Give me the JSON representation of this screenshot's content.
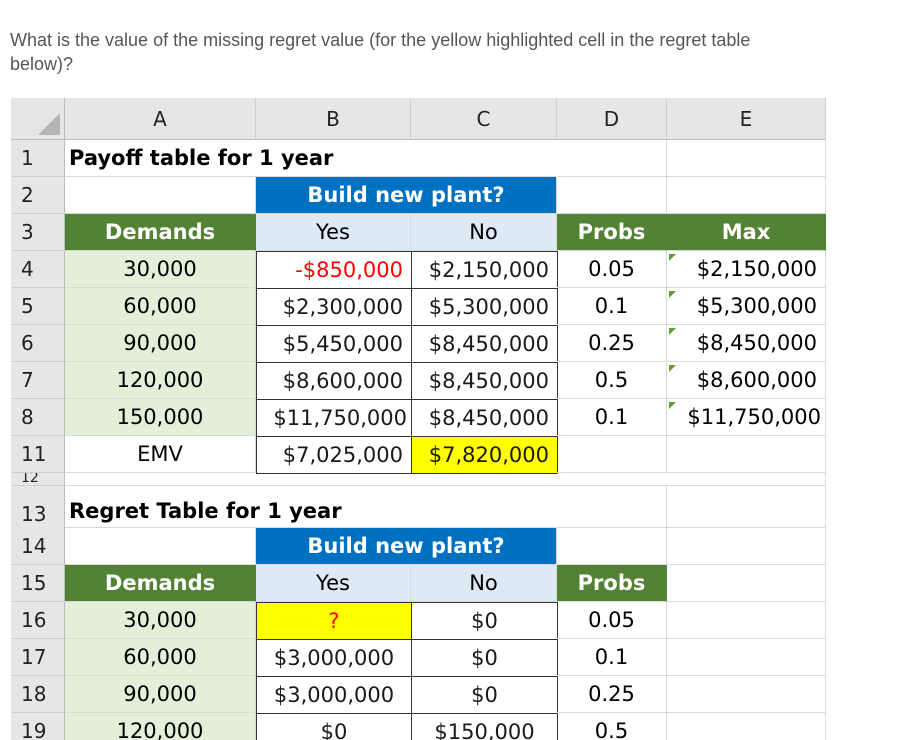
{
  "question": "What is the value of the missing regret value (for the yellow highlighted cell in the regret table below)?",
  "columns": [
    "A",
    "B",
    "C",
    "D",
    "E"
  ],
  "row_numbers": [
    "1",
    "2",
    "3",
    "4",
    "5",
    "6",
    "7",
    "8",
    "11",
    "12",
    "13",
    "14",
    "15",
    "16",
    "17",
    "18",
    "19"
  ],
  "payoff": {
    "title": "Payoff table for 1 year",
    "decision_header": "Build new plant?",
    "demands_header": "Demands",
    "yes_header": "Yes",
    "no_header": "No",
    "probs_header": "Probs",
    "max_header": "Max",
    "rows": [
      {
        "demand": "30,000",
        "yes": "-$850,000",
        "no": "$2,150,000",
        "prob": "0.05",
        "max": "$2,150,000"
      },
      {
        "demand": "60,000",
        "yes": "$2,300,000",
        "no": "$5,300,000",
        "prob": "0.1",
        "max": "$5,300,000"
      },
      {
        "demand": "90,000",
        "yes": "$5,450,000",
        "no": "$8,450,000",
        "prob": "0.25",
        "max": "$8,450,000"
      },
      {
        "demand": "120,000",
        "yes": "$8,600,000",
        "no": "$8,450,000",
        "prob": "0.5",
        "max": "$8,600,000"
      },
      {
        "demand": "150,000",
        "yes": "$11,750,000",
        "no": "$8,450,000",
        "prob": "0.1",
        "max": "$11,750,000"
      }
    ],
    "emv_label": "EMV",
    "emv_yes": "$7,025,000",
    "emv_no": "$7,820,000"
  },
  "regret": {
    "title": "Regret Table for 1 year",
    "decision_header": "Build new plant?",
    "demands_header": "Demands",
    "yes_header": "Yes",
    "no_header": "No",
    "probs_header": "Probs",
    "rows": [
      {
        "demand": "30,000",
        "yes": "?",
        "no": "$0",
        "prob": "0.05"
      },
      {
        "demand": "60,000",
        "yes": "$3,000,000",
        "no": "$0",
        "prob": "0.1"
      },
      {
        "demand": "90,000",
        "yes": "$3,000,000",
        "no": "$0",
        "prob": "0.25"
      },
      {
        "demand": "120,000",
        "yes": "$0",
        "no": "$150,000",
        "prob": "0.5"
      }
    ]
  },
  "colors": {
    "header_green": "#548235",
    "header_blue": "#0070c0",
    "highlight_yellow": "#ffff00",
    "negative_red": "#ff0000"
  }
}
